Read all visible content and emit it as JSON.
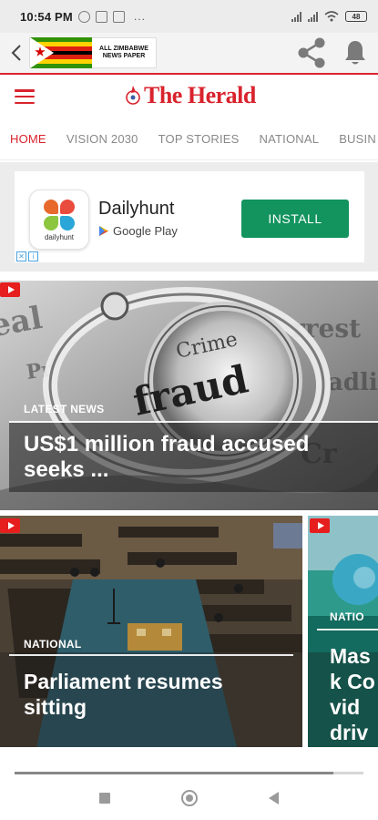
{
  "status_bar": {
    "time": "10:54 PM",
    "notification_icons": [
      "whatsapp-icon",
      "sim-icon",
      "mail-icon"
    ],
    "overflow": "...",
    "battery": "48"
  },
  "app_toolbar": {
    "banner_text": "ALL ZIMBABWE NEWS PAPER",
    "icons": [
      "back-arrow-icon",
      "share-icon",
      "bell-icon"
    ]
  },
  "header": {
    "brand": "The Herald",
    "accent_color": "#d9232d"
  },
  "nav": {
    "tabs": [
      {
        "label": "HOME",
        "active": true
      },
      {
        "label": "VISION 2030",
        "active": false
      },
      {
        "label": "TOP STORIES",
        "active": false
      },
      {
        "label": "NATIONAL",
        "active": false
      },
      {
        "label": "BUSIN",
        "active": false
      }
    ]
  },
  "ad": {
    "app_icon_label": "dailyhunt",
    "title": "Dailyhunt",
    "store": "Google Play",
    "cta": "INSTALL",
    "cta_color": "#13935e"
  },
  "hero": {
    "category": "LATEST NEWS",
    "headline": "US$1 million fraud accused seeks ..."
  },
  "cards": [
    {
      "category": "NATIONAL",
      "headline": "Parliament resumes sitting"
    },
    {
      "category": "NATIO",
      "headline": "Mask Covid drive"
    }
  ]
}
